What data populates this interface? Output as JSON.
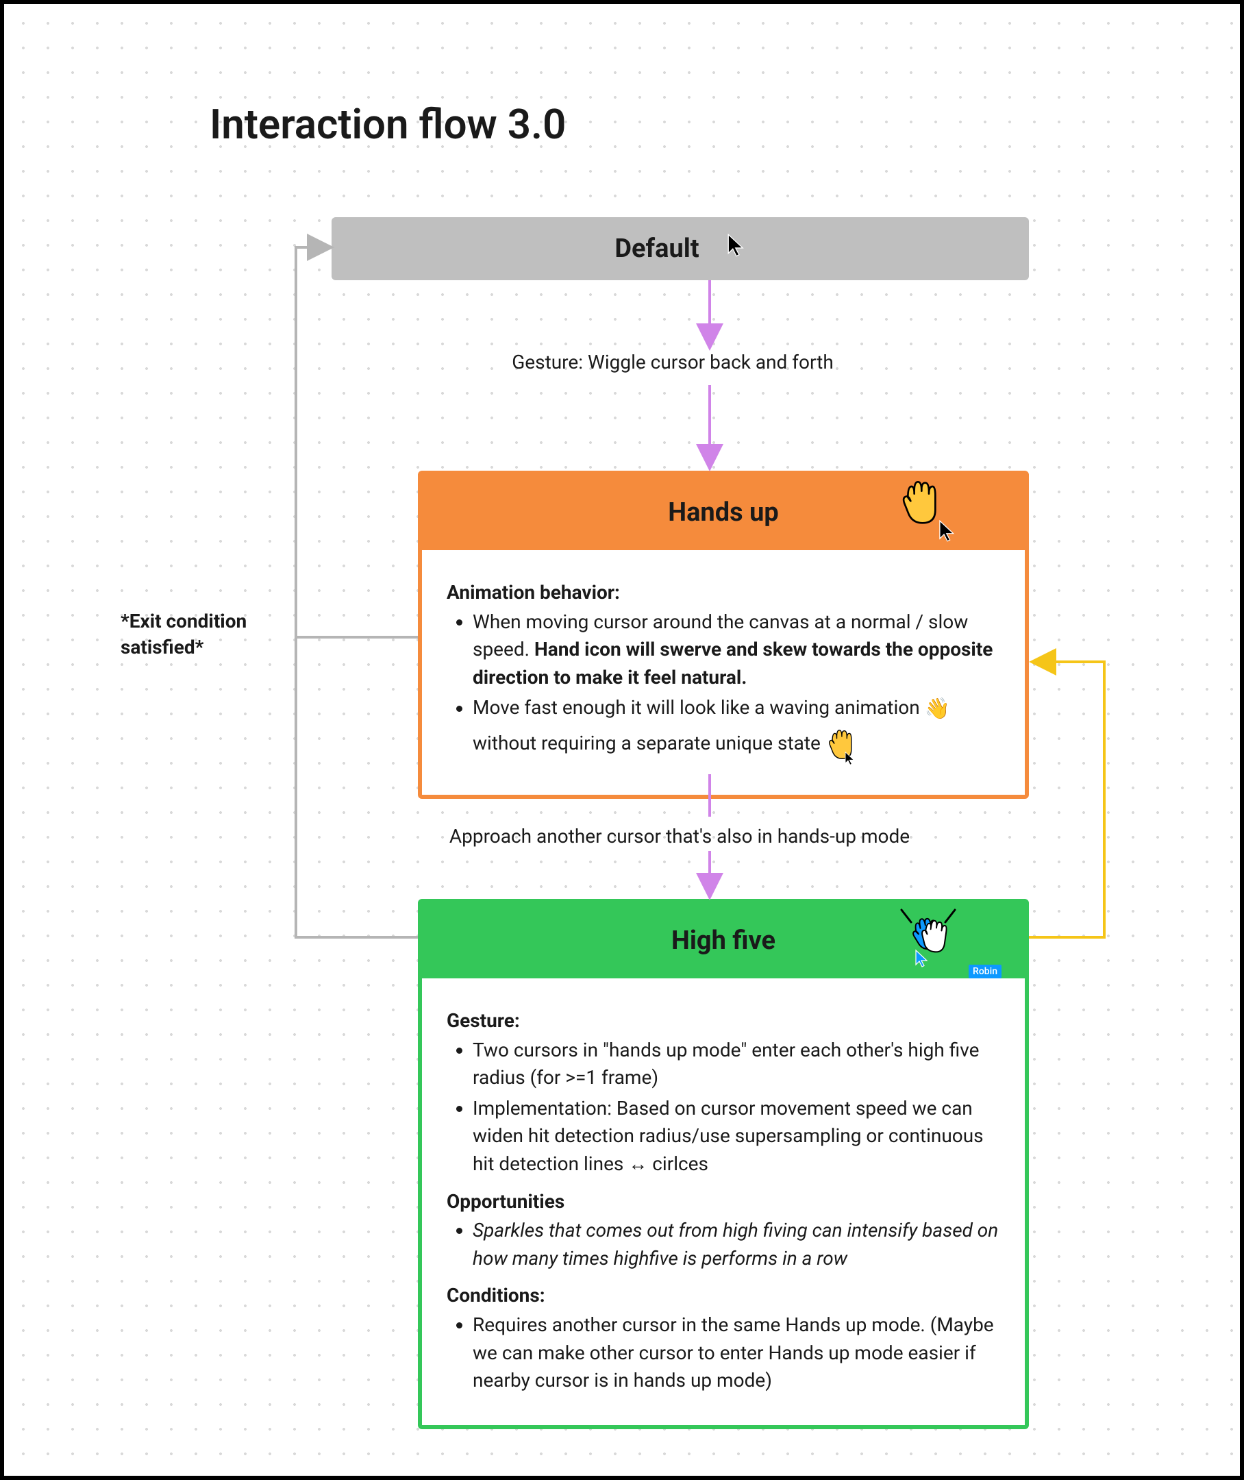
{
  "title": "Interaction flow 3.0",
  "states": {
    "default": {
      "label": "Default"
    },
    "handsup": {
      "label": "Hands up",
      "section1_title": "Animation behavior:",
      "bullet1a": "When moving cursor around the canvas at a normal / slow speed. ",
      "bullet1b_bold": "Hand icon will swerve and skew towards the opposite direction to make it feel natural.",
      "bullet2a": "Move fast enough it will look like a waving animation ",
      "bullet2b": " without requiring a separate unique state "
    },
    "highfive": {
      "label": "High five",
      "gesture_title": "Gesture:",
      "gesture_b1": "Two cursors in \"hands up mode\" enter each other's high five radius (for >=1 frame)",
      "gesture_b2": "Implementation: Based on cursor movement speed we can widen hit detection radius/use supersampling or continuous hit detection lines ↔ cirlces",
      "opp_title": "Opportunities",
      "opp_b1": "Sparkles that comes out from high fiving can intensify based on how many times highfive is performs in a row",
      "cond_title": "Conditions:",
      "cond_b1": "Requires another cursor in the same Hands up mode. (Maybe we can make other cursor to enter Hands up mode easier if nearby cursor is in hands up mode)"
    }
  },
  "transitions": {
    "t1": "Gesture: Wiggle cursor back and forth",
    "t2": "Approach another cursor that's also in hands-up mode",
    "exit": "*Exit condition satisfied*"
  },
  "collaborator": {
    "name": "Robin"
  }
}
